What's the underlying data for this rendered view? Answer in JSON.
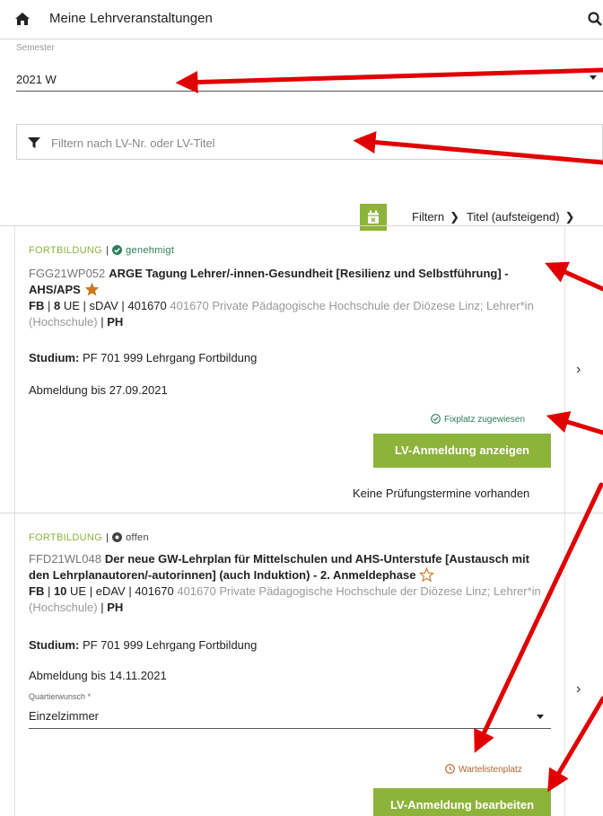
{
  "header": {
    "title": "Meine Lehrveranstaltungen",
    "home_icon": "home-icon",
    "search_icon": "search-icon"
  },
  "semester": {
    "label": "Semester",
    "value": "2021 W"
  },
  "filter": {
    "placeholder": "Filtern nach LV-Nr. oder LV-Titel",
    "value": "",
    "icon": "filter-icon"
  },
  "toolbar": {
    "calendar_icon": "calendar-export-icon",
    "filter_label": "Filtern",
    "sort_label": "Titel (aufsteigend)"
  },
  "courses": [
    {
      "category": "FORTBILDUNG",
      "status": "genehmigt",
      "code": "FGG21WP052",
      "title": "ARGE Tagung Lehrer/-innen-Gesundheit [Resilienz und Selbstführung] - AHS/APS",
      "favorite": true,
      "type": "FB",
      "ue": "8",
      "ue_label": "UE",
      "dav": "sDAV",
      "org_code": "401670",
      "org_name": "401670 Private Pädagogische Hochschule der Diözese Linz; Lehrer*in (Hochschule)",
      "institution": "PH",
      "studium_label": "Studium:",
      "studium": "PF 701 999 Lehrgang Fortbildung",
      "deregister": "Abmeldung bis 27.09.2021",
      "assignment": "Fixplatz zugewiesen",
      "button": "LV-Anmeldung anzeigen",
      "exams": "Keine Prüfungstermine vorhanden"
    },
    {
      "category": "FORTBILDUNG",
      "status": "offen",
      "code": "FFD21WL048",
      "title": "Der neue GW-Lehrplan für Mittelschulen und AHS-Unterstufe [Austausch mit den Lehrplanautoren/-autorinnen] (auch Induktion) - 2. Anmeldephase",
      "favorite": false,
      "type": "FB",
      "ue": "10",
      "ue_label": "UE",
      "dav": "eDAV",
      "org_code": "401670",
      "org_name": "401670 Private Pädagogische Hochschule der Diözese Linz; Lehrer*in (Hochschule)",
      "institution": "PH",
      "studium_label": "Studium:",
      "studium": "PF 701 999 Lehrgang Fortbildung",
      "deregister": "Abmeldung bis 14.11.2021",
      "quarter_label": "Quartierwunsch *",
      "quarter_value": "Einzelzimmer",
      "assignment": "Wartelistenplatz",
      "button": "LV-Anmeldung bearbeiten"
    }
  ],
  "colors": {
    "accent_green": "#8db33a",
    "status_ok": "#2e7d5b",
    "waitlist": "#b5622a",
    "favorite_star": "#c8781f",
    "annotation_arrow": "#e00000"
  }
}
